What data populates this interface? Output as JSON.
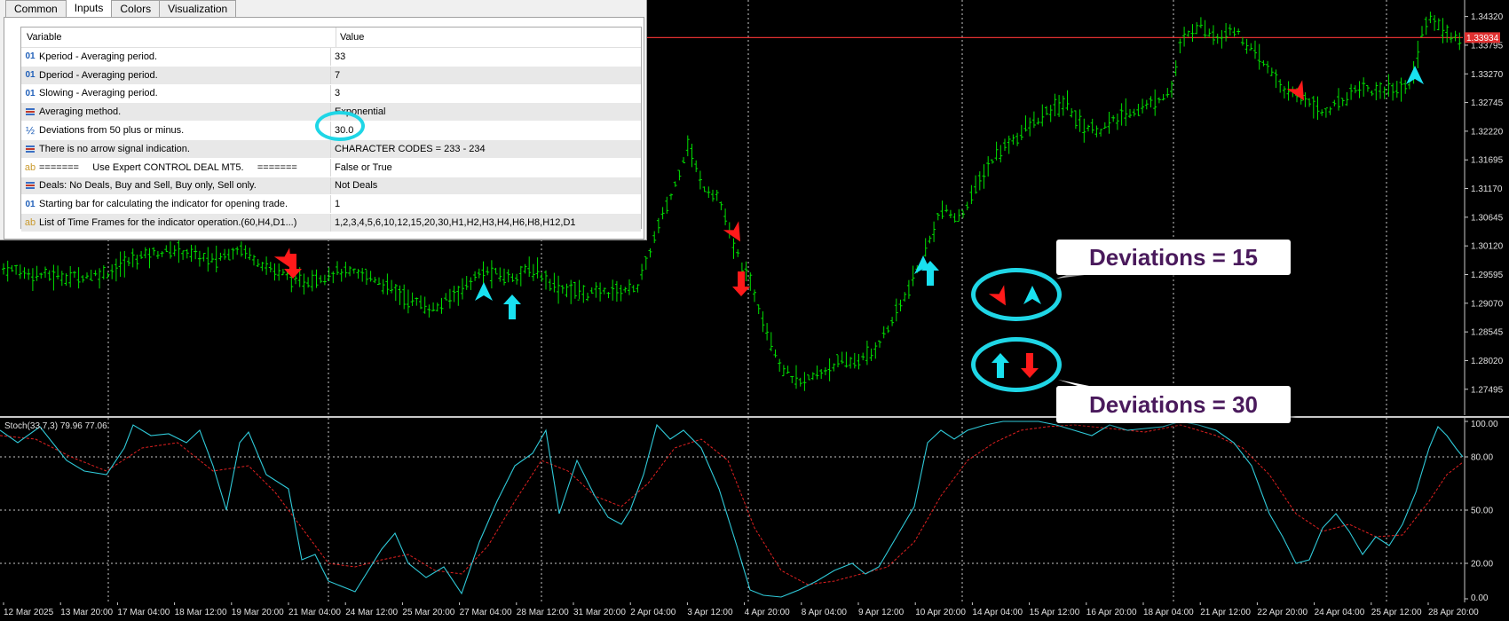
{
  "dialog": {
    "tabs": [
      {
        "label": "Common",
        "active": false
      },
      {
        "label": "Inputs",
        "active": true
      },
      {
        "label": "Colors",
        "active": false
      },
      {
        "label": "Visualization",
        "active": false
      }
    ],
    "columns": {
      "variable": "Variable",
      "value": "Value"
    },
    "rows": [
      {
        "icon": "number-icon",
        "variable": "Kperiod - Averaging period.",
        "value": "33"
      },
      {
        "icon": "number-icon",
        "variable": "Dperiod - Averaging period.",
        "value": "7"
      },
      {
        "icon": "number-icon",
        "variable": "Slowing - Averaging period.",
        "value": "3"
      },
      {
        "icon": "enum-icon",
        "variable": "Averaging method.",
        "value": "Exponential"
      },
      {
        "icon": "fraction-icon",
        "variable": "Deviations from 50 plus or minus.",
        "value": "30.0"
      },
      {
        "icon": "enum-icon",
        "variable": "There is no arrow signal indication.",
        "value": "CHARACTER CODES = 233 - 234"
      },
      {
        "icon": "text-icon",
        "variable": "=======     Use Expert CONTROL DEAL MT5.     =======",
        "value": "False or True"
      },
      {
        "icon": "enum-icon",
        "variable": "Deals: No Deals, Buy and Sell, Buy only, Sell only.",
        "value": "Not Deals"
      },
      {
        "icon": "number-icon",
        "variable": "Starting bar for calculating the indicator for opening trade.",
        "value": "1"
      },
      {
        "icon": "text-icon",
        "variable": "List of Time Frames for the indicator operation.(60,H4,D1...)",
        "value": "1,2,3,4,5,6,10,12,15,20,30,H1,H2,H3,H4,H6,H8,H12,D1"
      }
    ],
    "icon_glyphs": {
      "number": "01",
      "fraction": "½",
      "text": "ab"
    }
  },
  "main_chart": {
    "price_labels": [
      "1.34320",
      "1.33795",
      "1.33270",
      "1.32745",
      "1.32220",
      "1.31695",
      "1.31170",
      "1.30645",
      "1.30120",
      "1.29595",
      "1.29070",
      "1.28545",
      "1.28020",
      "1.27495"
    ],
    "current_price": "1.33934",
    "price_range": [
      1.2715,
      1.3446
    ],
    "current_price_value": 1.33934,
    "bar_color": "#00e000",
    "hline_color": "#e03030",
    "arrow_up_color": "#19e1f0",
    "arrow_down_color": "#ff1a1a"
  },
  "callouts": {
    "dev15": "Deviations = 15",
    "dev30": "Deviations = 30"
  },
  "stoch": {
    "label": "Stoch(33,7,3) 79.96 77.06",
    "levels": [
      "100.00",
      "80.00",
      "50.00",
      "20.00",
      "0.00"
    ],
    "main_color": "#2fc9d8",
    "signal_color": "#e02020"
  },
  "time_axis": {
    "labels": [
      "12 Mar 2025",
      "13 Mar 20:00",
      "17 Mar 04:00",
      "18 Mar 12:00",
      "19 Mar 20:00",
      "21 Mar 04:00",
      "24 Mar 12:00",
      "25 Mar 20:00",
      "27 Mar 04:00",
      "28 Mar 12:00",
      "31 Mar 20:00",
      "2 Apr 04:00",
      "3 Apr 12:00",
      "4 Apr 20:00",
      "8 Apr 04:00",
      "9 Apr 12:00",
      "10 Apr 20:00",
      "14 Apr 04:00",
      "15 Apr 12:00",
      "16 Apr 20:00",
      "18 Apr 04:00",
      "21 Apr 12:00",
      "22 Apr 20:00",
      "24 Apr 04:00",
      "25 Apr 12:00",
      "28 Apr 20:00"
    ]
  }
}
